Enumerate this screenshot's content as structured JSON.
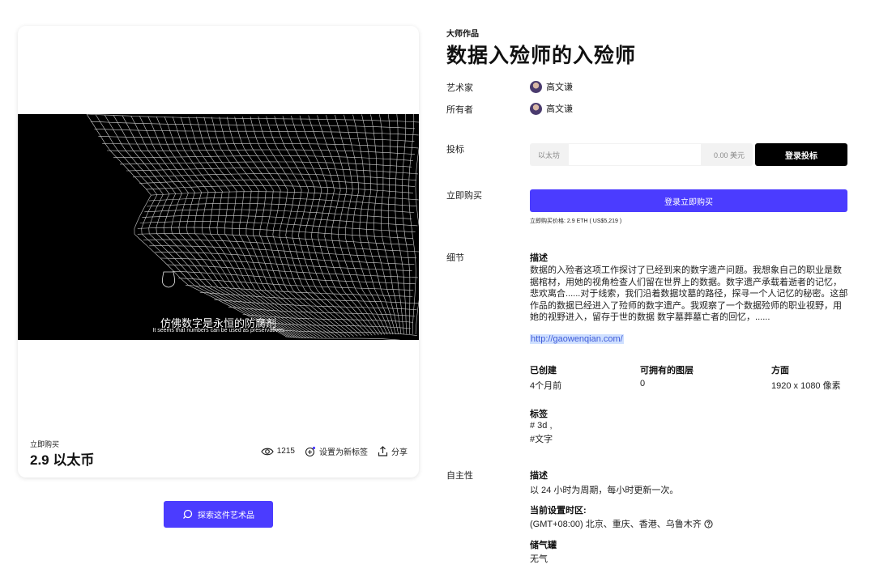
{
  "card": {
    "subtitle_cn": "仿佛数字是永恒的防腐剂",
    "subtitle_en": "It seems that numbers can be used as preservatives",
    "buy_label": "立即购买",
    "price": "2.9 以太币",
    "views": "1215",
    "set_tag": "设置为新标签",
    "share": "分享"
  },
  "explore_button": "探索这件艺术品",
  "details": {
    "kicker": "大师作品",
    "title": "数据入殓师的入殓师",
    "artist_label": "艺术家",
    "artist_name": "高文谦",
    "owner_label": "所有者",
    "owner_name": "高文谦",
    "bid_label": "投标",
    "bid_currency": "以太坊",
    "bid_value": "",
    "bid_usd": "0.00 美元",
    "bid_button": "登录投标",
    "buy_now_label": "立即购买",
    "buy_now_button": "登录立即购买",
    "buy_now_note": "立即购买价格: 2.9 ETH ( US$5,219 )",
    "detail_label": "细节",
    "desc_heading": "描述",
    "desc_text": "数据的入殓者这项工作探讨了已经到来的数字遗产问题。我想象自己的职业是数据棺材，用她的视角检查人们留在世界上的数据。数字遗产承载着逝者的记忆，悲欢离合......对于线索，我们沿着数据坟墓的路径，探寻一个人记忆的秘密。这部作品的数据已经进入了殓师的数字遗产。我观察了一个数据殓师的职业视野，用她的视野进入，留存于世的数据 数字墓葬墓亡者的回忆，......",
    "link": "http://gaowenqian.com/",
    "created_label": "已创建",
    "created_value": "4个月前",
    "layers_label": "可拥有的图层",
    "layers_value": "0",
    "aspect_label": "方面",
    "aspect_value": "1920 x 1080 像素",
    "tags_label": "标签",
    "tags": [
      "# 3d ,",
      "#文字"
    ]
  },
  "autonomy": {
    "label": "自主性",
    "desc_heading": "描述",
    "desc_text": "以 24 小时为周期，每小时更新一次。",
    "tz_heading": "当前设置时区:",
    "tz_value": "(GMT+08:00) 北京、重庆、香港、乌鲁木齐",
    "tank_heading": "储气罐",
    "tank_value": "无气"
  },
  "colors": {
    "accent": "#4b3cff",
    "dark_button": "#000000",
    "link": "#3f5bd9"
  }
}
